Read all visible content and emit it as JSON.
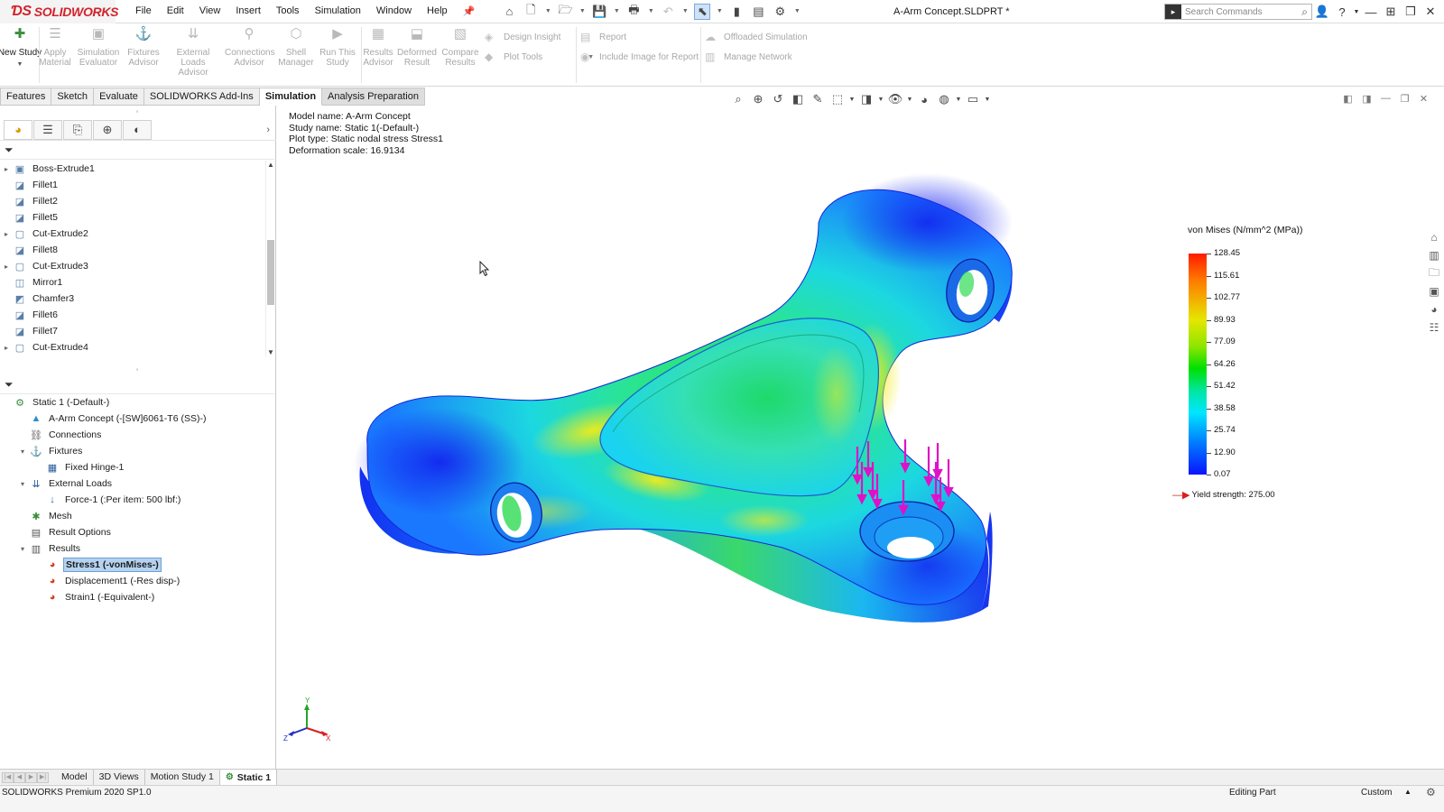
{
  "app": {
    "logo_text": "SOLIDWORKS",
    "document_title": "A-Arm Concept.SLDPRT *",
    "menus": [
      "File",
      "Edit",
      "View",
      "Insert",
      "Tools",
      "Simulation",
      "Window",
      "Help"
    ],
    "search_placeholder": "Search Commands"
  },
  "ribbon": {
    "buttons": [
      {
        "label": "New Study",
        "icon": "new-study-icon",
        "enabled": true
      },
      {
        "label": "Apply Material",
        "icon": "apply-material-icon",
        "enabled": false
      },
      {
        "label": "Simulation Evaluator",
        "icon": "simulation-evaluator-icon",
        "enabled": false
      },
      {
        "label": "Fixtures Advisor",
        "icon": "fixtures-advisor-icon",
        "enabled": false
      },
      {
        "label": "External Loads Advisor",
        "icon": "external-loads-icon",
        "enabled": false
      },
      {
        "label": "Connections Advisor",
        "icon": "connections-advisor-icon",
        "enabled": false
      },
      {
        "label": "Shell Manager",
        "icon": "shell-manager-icon",
        "enabled": false
      },
      {
        "label": "Run This Study",
        "icon": "run-study-icon",
        "enabled": false
      },
      {
        "label": "Results Advisor",
        "icon": "results-advisor-icon",
        "enabled": false
      },
      {
        "label": "Deformed Result",
        "icon": "deformed-result-icon",
        "enabled": false
      },
      {
        "label": "Compare Results",
        "icon": "compare-results-icon",
        "enabled": false
      }
    ],
    "small_buttons": [
      {
        "label": "Design Insight",
        "icon": "design-insight-icon"
      },
      {
        "label": "Plot Tools",
        "icon": "plot-tools-icon"
      },
      {
        "label": "Report",
        "icon": "report-icon"
      },
      {
        "label": "Include Image for Report",
        "icon": "include-image-icon"
      },
      {
        "label": "Offloaded Simulation",
        "icon": "offloaded-simulation-icon"
      },
      {
        "label": "Manage Network",
        "icon": "manage-network-icon"
      }
    ]
  },
  "command_tabs": [
    "Features",
    "Sketch",
    "Evaluate",
    "SOLIDWORKS Add-Ins",
    "Simulation",
    "Analysis Preparation"
  ],
  "active_command_tab": "Simulation",
  "feature_tree": [
    {
      "label": "Boss-Extrude1",
      "expandable": true,
      "icon": "boss-extrude-icon"
    },
    {
      "label": "Fillet1",
      "expandable": false,
      "icon": "fillet-icon"
    },
    {
      "label": "Fillet2",
      "expandable": false,
      "icon": "fillet-icon"
    },
    {
      "label": "Fillet5",
      "expandable": false,
      "icon": "fillet-icon"
    },
    {
      "label": "Cut-Extrude2",
      "expandable": true,
      "icon": "cut-extrude-icon"
    },
    {
      "label": "Fillet8",
      "expandable": false,
      "icon": "fillet-icon"
    },
    {
      "label": "Cut-Extrude3",
      "expandable": true,
      "icon": "cut-extrude-icon"
    },
    {
      "label": "Mirror1",
      "expandable": false,
      "icon": "mirror-icon"
    },
    {
      "label": "Chamfer3",
      "expandable": false,
      "icon": "chamfer-icon"
    },
    {
      "label": "Fillet6",
      "expandable": false,
      "icon": "fillet-icon"
    },
    {
      "label": "Fillet7",
      "expandable": false,
      "icon": "fillet-icon"
    },
    {
      "label": "Cut-Extrude4",
      "expandable": true,
      "icon": "cut-extrude-icon"
    }
  ],
  "study_tree": [
    {
      "label": "Static 1 (-Default-)",
      "level": 0,
      "icon": "static-study-icon",
      "expand": ""
    },
    {
      "label": "A-Arm Concept (-[SW]6061-T6 (SS)-)",
      "level": 1,
      "icon": "part-material-icon",
      "expand": ""
    },
    {
      "label": "Connections",
      "level": 1,
      "icon": "connections-icon",
      "expand": ""
    },
    {
      "label": "Fixtures",
      "level": 1,
      "icon": "fixtures-icon",
      "expand": "open"
    },
    {
      "label": "Fixed Hinge-1",
      "level": 2,
      "icon": "fixed-hinge-icon",
      "expand": ""
    },
    {
      "label": "External Loads",
      "level": 1,
      "icon": "external-loads-icon",
      "expand": "open"
    },
    {
      "label": "Force-1 (:Per item: 500 lbf:)",
      "level": 2,
      "icon": "force-icon",
      "expand": ""
    },
    {
      "label": "Mesh",
      "level": 1,
      "icon": "mesh-icon",
      "expand": ""
    },
    {
      "label": "Result Options",
      "level": 1,
      "icon": "result-options-icon",
      "expand": ""
    },
    {
      "label": "Results",
      "level": 1,
      "icon": "results-folder-icon",
      "expand": "open"
    },
    {
      "label": "Stress1 (-vonMises-)",
      "level": 2,
      "icon": "stress-plot-icon",
      "expand": "",
      "selected": true
    },
    {
      "label": "Displacement1 (-Res disp-)",
      "level": 2,
      "icon": "displacement-plot-icon",
      "expand": ""
    },
    {
      "label": "Strain1 (-Equivalent-)",
      "level": 2,
      "icon": "strain-plot-icon",
      "expand": ""
    }
  ],
  "study_info": {
    "model_name": "Model name: A-Arm Concept",
    "study_name": "Study name: Static 1(-Default-)",
    "plot_type": "Plot type: Static nodal stress Stress1",
    "deformation_scale": "Deformation scale: 16.9134"
  },
  "legend": {
    "title": "von Mises (N/mm^2 (MPa))",
    "ticks": [
      "128.45",
      "115.61",
      "102.77",
      "89.93",
      "77.09",
      "64.26",
      "51.42",
      "38.58",
      "25.74",
      "12.90",
      "0.07"
    ],
    "yield_label": "Yield strength: 275.00",
    "colors": {
      "max": "#ff1a00",
      "mid": "#00e000",
      "min": "#0a14ff",
      "yield_arrow": "#d81e1e",
      "load_arrow": "#e010c8"
    }
  },
  "triad": {
    "x": "X",
    "y": "Y",
    "z": "Z"
  },
  "bottom_tabs": [
    "Model",
    "3D Views",
    "Motion Study 1",
    "Static 1"
  ],
  "active_bottom_tab": "Static 1",
  "status": {
    "version": "SOLIDWORKS Premium 2020 SP1.0",
    "mode": "Editing Part",
    "units": "Custom"
  }
}
